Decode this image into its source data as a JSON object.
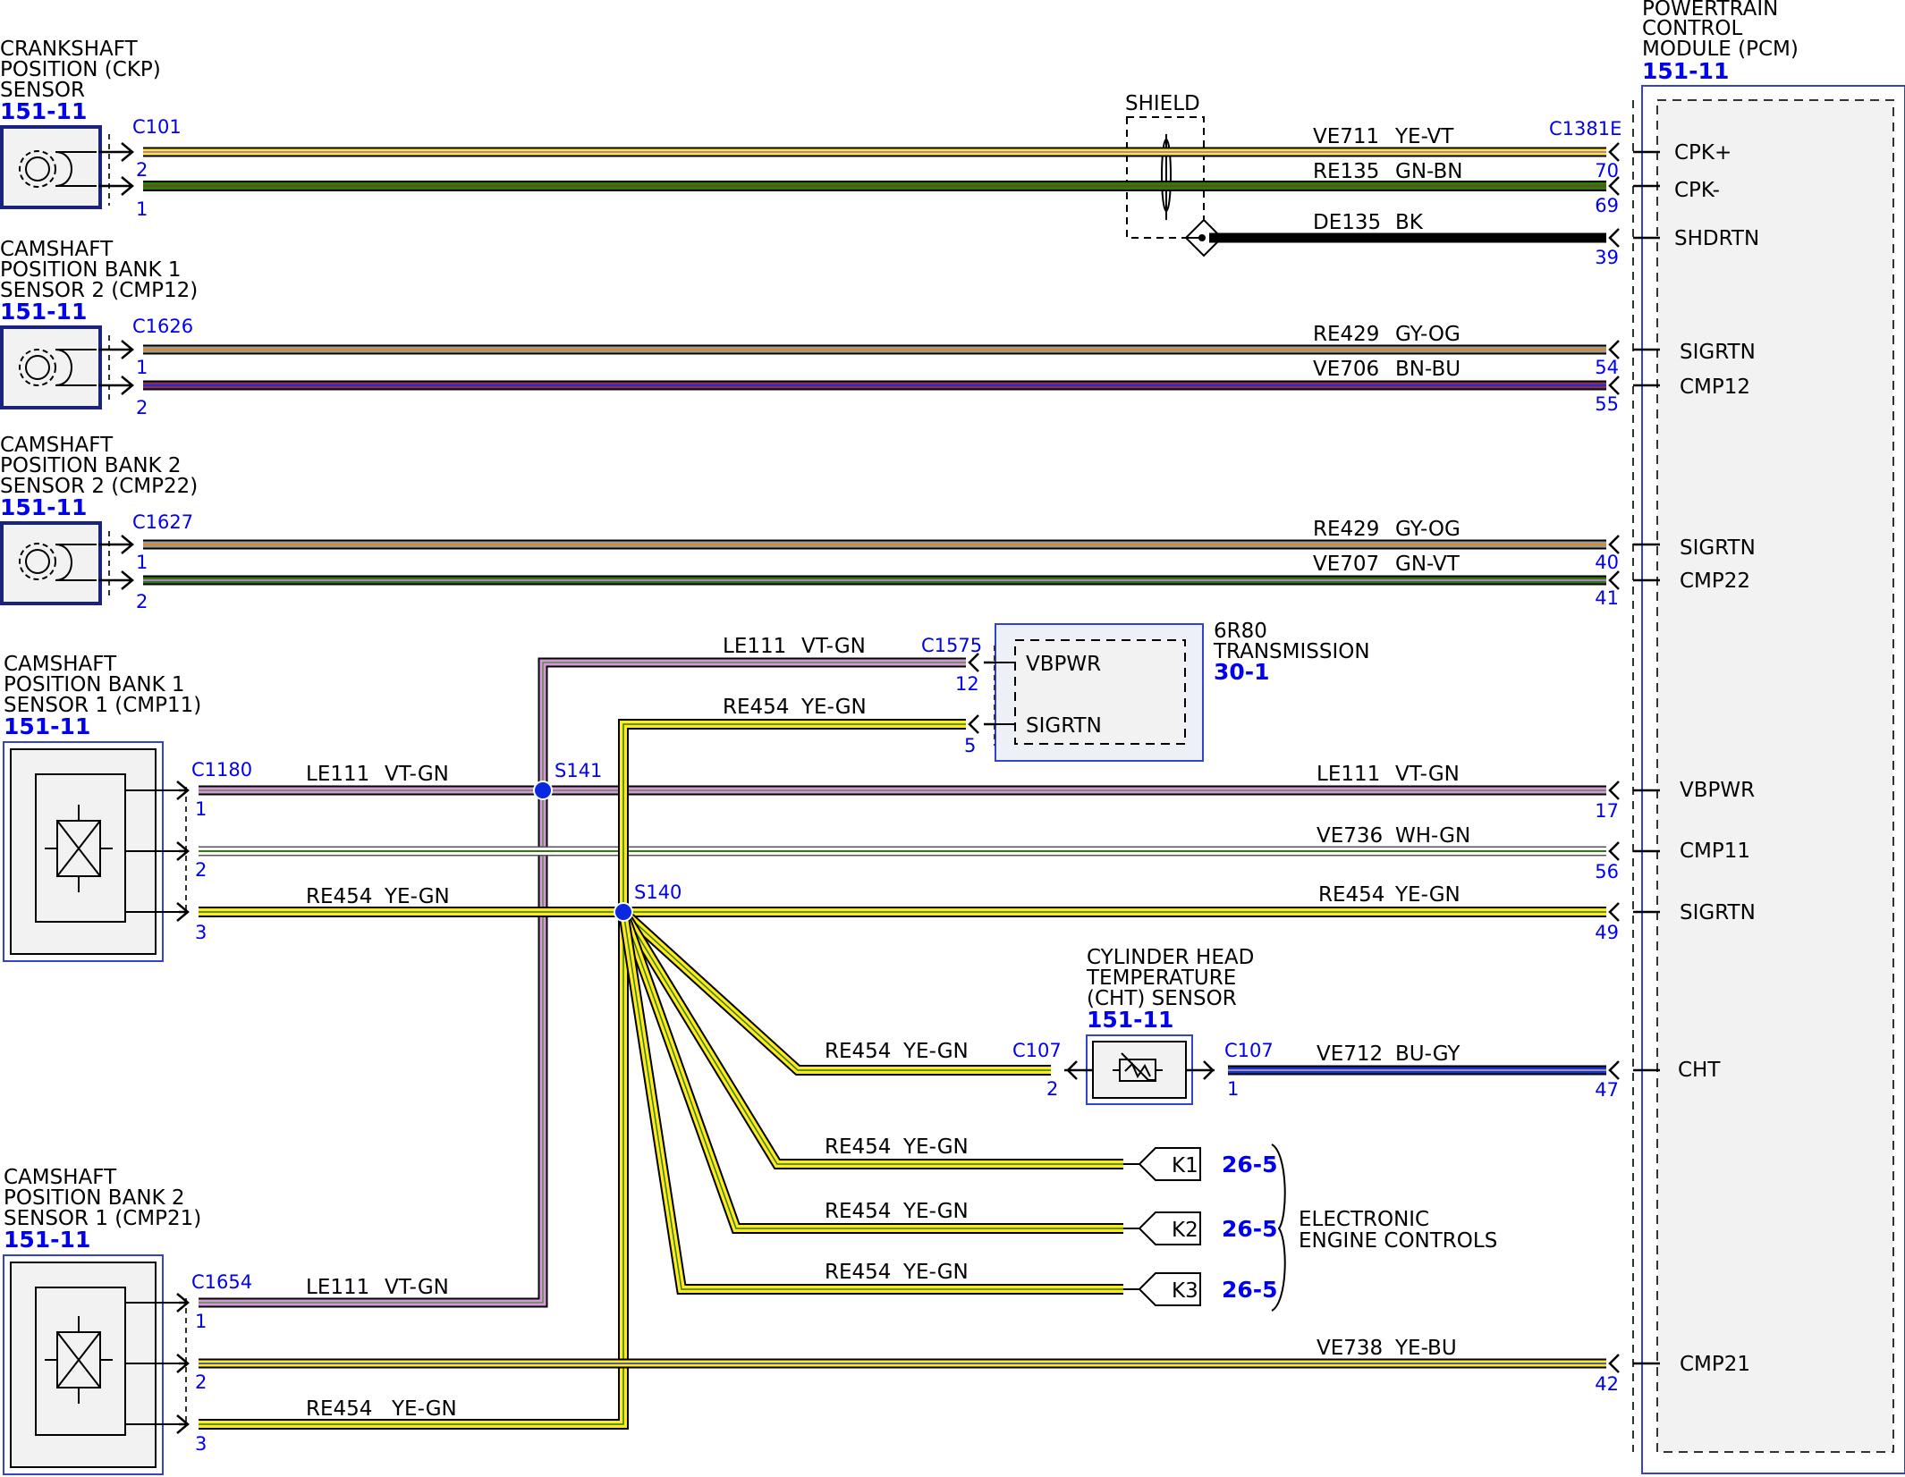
{
  "colors": {
    "YE": "#ffea1f",
    "VT": "#cf8ad6",
    "GN": "#2f7a0c",
    "BN": "#8b5a1e",
    "GY": "#9a9a9a",
    "OG": "#e08a1e",
    "BU": "#1a30d8",
    "WH": "#ffffff",
    "BK": "#000000",
    "accent": "#0000ee"
  },
  "components": {
    "ckp": {
      "lines": [
        "CRANKSHAFT",
        "POSITION (CKP)",
        "SENSOR"
      ],
      "ref": "151-11",
      "icon": "gear-icon"
    },
    "cmp12": {
      "lines": [
        "CAMSHAFT",
        "POSITION BANK 1",
        "SENSOR 2 (CMP12)"
      ],
      "ref": "151-11",
      "icon": "gear-icon"
    },
    "cmp22": {
      "lines": [
        "CAMSHAFT",
        "POSITION BANK 2",
        "SENSOR 2 (CMP22)"
      ],
      "ref": "151-11",
      "icon": "gear-icon"
    },
    "cmp11": {
      "lines": [
        "CAMSHAFT",
        "POSITION BANK 1",
        "SENSOR 1 (CMP11)"
      ],
      "ref": "151-11",
      "icon": "hall-sensor-icon"
    },
    "cmp21": {
      "lines": [
        "CAMSHAFT",
        "POSITION BANK 2",
        "SENSOR 1 (CMP21)"
      ],
      "ref": "151-11",
      "icon": "hall-sensor-icon"
    },
    "pcm": {
      "lines": [
        "POWERTRAIN",
        "CONTROL",
        "MODULE (PCM)"
      ],
      "ref": "151-11"
    },
    "trans": {
      "lines": [
        "6R80",
        "TRANSMISSION"
      ],
      "ref": "30-1",
      "pin_vbpwr": "VBPWR",
      "pin_sigrtn": "SIGRTN"
    },
    "cht": {
      "lines": [
        "CYLINDER HEAD",
        "TEMPERATURE",
        "(CHT) SENSOR"
      ],
      "ref": "151-11",
      "icon": "thermistor-icon"
    },
    "shield": {
      "label": "SHIELD"
    },
    "eec": {
      "lines": [
        "ELECTRONIC",
        "ENGINE CONTROLS"
      ]
    }
  },
  "connectors": {
    "c101": "C101",
    "c1626": "C1626",
    "c1627": "C1627",
    "c1180": "C1180",
    "c1654": "C1654",
    "c1575": "C1575",
    "c1381e": "C1381E",
    "c107a": "C107",
    "c107b": "C107"
  },
  "splices": {
    "s141": "S141",
    "s140": "S140"
  },
  "pcm_pins": {
    "cpk_plus": {
      "name": "CPK+",
      "pin": "70"
    },
    "cpk_minus": {
      "name": "CPK-",
      "pin": "69"
    },
    "shdrtn": {
      "name": "SHDRTN",
      "pin": "39"
    },
    "sigrtn_54": {
      "name": "SIGRTN",
      "pin": "54"
    },
    "cmp12": {
      "name": "CMP12",
      "pin": "55"
    },
    "sigrtn_40": {
      "name": "SIGRTN",
      "pin": "40"
    },
    "cmp22": {
      "name": "CMP22",
      "pin": "41"
    },
    "vbpwr": {
      "name": "VBPWR",
      "pin": "17"
    },
    "cmp11": {
      "name": "CMP11",
      "pin": "56"
    },
    "sigrtn_49": {
      "name": "SIGRTN",
      "pin": "49"
    },
    "cht": {
      "name": "CHT",
      "pin": "47"
    },
    "cmp21": {
      "name": "CMP21",
      "pin": "42"
    }
  },
  "sensor_pins": {
    "ckp_a": "2",
    "ckp_b": "1",
    "cmp12_a": "1",
    "cmp12_b": "2",
    "cmp22_a": "1",
    "cmp22_b": "2",
    "cmp11_a": "1",
    "cmp11_b": "2",
    "cmp11_c": "3",
    "cmp21_a": "1",
    "cmp21_b": "2",
    "cmp21_c": "3",
    "trans_a": "12",
    "trans_b": "5",
    "cht_a": "2",
    "cht_b": "1"
  },
  "wires": {
    "ve711": {
      "circuit": "VE711",
      "color": "YE-VT"
    },
    "re135": {
      "circuit": "RE135",
      "color": "GN-BN"
    },
    "de135": {
      "circuit": "DE135",
      "color": "BK"
    },
    "re429a": {
      "circuit": "RE429",
      "color": "GY-OG"
    },
    "ve706": {
      "circuit": "VE706",
      "color": "BN-BU"
    },
    "re429b": {
      "circuit": "RE429",
      "color": "GY-OG"
    },
    "ve707": {
      "circuit": "VE707",
      "color": "GN-VT"
    },
    "le111_trans": {
      "circuit": "LE111",
      "color": "VT-GN"
    },
    "re454_trans": {
      "circuit": "RE454",
      "color": "YE-GN"
    },
    "le111_cmp11": {
      "circuit": "LE111",
      "color": "VT-GN"
    },
    "le111_pcm": {
      "circuit": "LE111",
      "color": "VT-GN"
    },
    "ve736": {
      "circuit": "VE736",
      "color": "WH-GN"
    },
    "re454_cmp11": {
      "circuit": "RE454",
      "color": "YE-GN"
    },
    "re454_pcm": {
      "circuit": "RE454",
      "color": "YE-GN"
    },
    "re454_cht": {
      "circuit": "RE454",
      "color": "YE-GN"
    },
    "ve712": {
      "circuit": "VE712",
      "color": "BU-GY"
    },
    "re454_k1": {
      "circuit": "RE454",
      "color": "YE-GN"
    },
    "re454_k2": {
      "circuit": "RE454",
      "color": "YE-GN"
    },
    "re454_k3": {
      "circuit": "RE454",
      "color": "YE-GN"
    },
    "le111_cmp21": {
      "circuit": "LE111",
      "color": "VT-GN"
    },
    "ve738": {
      "circuit": "VE738",
      "color": "YE-BU"
    },
    "re454_cmp21": {
      "circuit": "RE454",
      "color": "YE-GN"
    }
  },
  "offpage": [
    {
      "label": "K1",
      "ref": "26-5"
    },
    {
      "label": "K2",
      "ref": "26-5"
    },
    {
      "label": "K3",
      "ref": "26-5"
    }
  ]
}
